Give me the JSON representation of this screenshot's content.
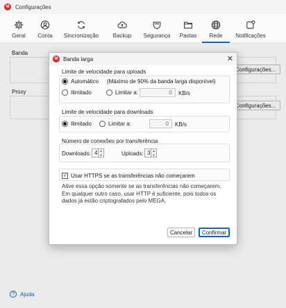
{
  "window": {
    "title": "Configurações",
    "logo_letter": "M"
  },
  "toolbar": {
    "items": [
      {
        "label": "Geral",
        "icon": "gear-icon"
      },
      {
        "label": "Conta",
        "icon": "account-icon"
      },
      {
        "label": "Sincronização",
        "icon": "sync-icon"
      },
      {
        "label": "Backup",
        "icon": "cloud-upload-icon"
      },
      {
        "label": "Segurança",
        "icon": "shield-icon"
      },
      {
        "label": "Pastas",
        "icon": "folder-icon"
      },
      {
        "label": "Rede",
        "icon": "globe-icon",
        "active": true
      },
      {
        "label": "Notificações",
        "icon": "notification-icon"
      }
    ],
    "accent": "#0a63c9"
  },
  "background": {
    "banda_label": "Banda",
    "proxy_label": "Proxy",
    "banda_button": "Configurações...",
    "proxy_button": "Configurações..."
  },
  "help": {
    "label": "Ajuda"
  },
  "dialog": {
    "title": "Banda larga",
    "close": "✕",
    "upload": {
      "title": "Limite de velocidade para uploads",
      "auto_label": "Automático",
      "auto_note": "(Máximo de 90% da banda larga disponível)",
      "unlimited_label": "Ilimitado",
      "limit_label": "Limitar a:",
      "limit_value": "0",
      "unit": "KB/s",
      "selected": "auto"
    },
    "download": {
      "title": "Limite de velocidade para downloads",
      "unlimited_label": "Ilimitado",
      "limit_label": "Limitar a:",
      "limit_value": "0",
      "unit": "KB/s",
      "selected": "unlimited"
    },
    "connections": {
      "title": "Número de conexões por transferência",
      "downloads_label": "Downloads:",
      "downloads_value": "4",
      "uploads_label": "Uploads:",
      "uploads_value": "3"
    },
    "https": {
      "label": "Usar HTTPS se as transferências não começarem",
      "checked": true,
      "info": "Ative essa opção somente se as transferências não começarem. Em qualquer outro caso, usar HTTP é suficiente, pois todos os dados já estão criptografados pelo MEGA."
    },
    "cancel_label": "Cancelar",
    "confirm_label": "Confirmar"
  }
}
